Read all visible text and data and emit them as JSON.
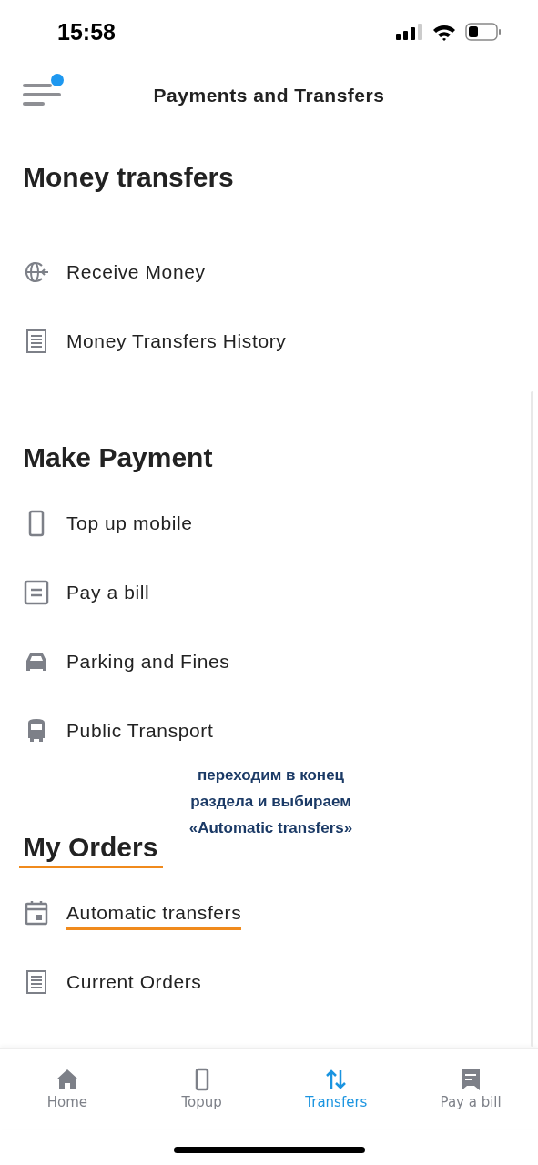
{
  "status_bar": {
    "time": "15:58"
  },
  "header": {
    "title": "Payments and Transfers",
    "menu_badge": true
  },
  "sections": [
    {
      "title": "Money transfers",
      "underlined": false,
      "items": [
        {
          "label": "Receive Money",
          "underlined": false
        },
        {
          "label": "Money Transfers History",
          "underlined": false
        }
      ]
    },
    {
      "title": "Make Payment",
      "underlined": false,
      "items": [
        {
          "label": "Top up mobile",
          "underlined": false
        },
        {
          "label": "Pay a bill",
          "underlined": false
        },
        {
          "label": "Parking and Fines",
          "underlined": false
        },
        {
          "label": "Public Transport",
          "underlined": false
        }
      ]
    },
    {
      "title": "My Orders",
      "underlined": true,
      "items": [
        {
          "label": "Automatic transfers",
          "underlined": true
        },
        {
          "label": "Current Orders",
          "underlined": false
        }
      ]
    }
  ],
  "annotation": {
    "lines": [
      "переходим в конец",
      "раздела и выбираем",
      "«Automatic transfers»"
    ]
  },
  "tab_bar": [
    {
      "label": "Home",
      "selected": false
    },
    {
      "label": "Topup",
      "selected": false
    },
    {
      "label": "Transfers",
      "selected": true
    },
    {
      "label": "Pay a bill",
      "selected": false
    }
  ]
}
